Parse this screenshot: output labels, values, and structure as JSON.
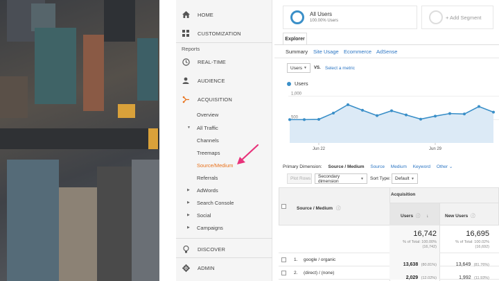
{
  "sidebar": {
    "home": "HOME",
    "customization": "CUSTOMIZATION",
    "reports_label": "Reports",
    "realtime": "REAL-TIME",
    "audience": "AUDIENCE",
    "acquisition": "ACQUISITION",
    "sub": {
      "overview": "Overview",
      "all_traffic": "All Traffic",
      "channels": "Channels",
      "treemaps": "Treemaps",
      "source_medium": "Source/Medium",
      "referrals": "Referrals",
      "adwords": "AdWords",
      "search_console": "Search Console",
      "social": "Social",
      "campaigns": "Campaigns"
    },
    "discover": "DISCOVER",
    "admin": "ADMIN"
  },
  "segments": {
    "all_users_title": "All Users",
    "all_users_sub": "100.00% Users",
    "add_segment": "+ Add Segment"
  },
  "explorer": {
    "tab_label": "Explorer",
    "tabs": [
      "Summary",
      "Site Usage",
      "Ecommerce",
      "AdSense"
    ],
    "metric_dropdown": "Users",
    "vs": "VS.",
    "select_metric": "Select a metric"
  },
  "chart_data": {
    "type": "line",
    "series": [
      {
        "name": "Users",
        "values": [
          500,
          500,
          505,
          640,
          820,
          700,
          585,
          690,
          600,
          510,
          575,
          630,
          620,
          780,
          660
        ]
      }
    ],
    "y_ticks": [
      "1,000",
      "500"
    ],
    "x_labels": [
      "Jun 22",
      "Jun 29"
    ],
    "ylim": [
      0,
      1100
    ],
    "color": "#3a8fc8"
  },
  "dimension": {
    "label": "Primary Dimension:",
    "selected": "Source / Medium",
    "options": [
      "Source",
      "Medium",
      "Keyword",
      "Other ⌄"
    ]
  },
  "toolbar": {
    "plot_rows": "Plot Rows",
    "secondary_dimension": "Secondary dimension",
    "sort_type_label": "Sort Type:",
    "sort_type_value": "Default"
  },
  "table": {
    "acquisition_header": "Acquisition",
    "col_source": "Source / Medium",
    "col_users": "Users",
    "col_new_users": "New Users",
    "totals": {
      "users": "16,742",
      "users_pct": "% of Total: 100.00%",
      "users_abs": "(16,742)",
      "new_users": "16,695",
      "new_users_pct": "% of Total: 100.02%",
      "new_users_abs": "(16,692)"
    },
    "rows": [
      {
        "idx": "1.",
        "source": "google / organic",
        "users": "13,638",
        "users_pct": "(80.81%)",
        "new_users": "13,649",
        "new_users_pct": "(81.76%)"
      },
      {
        "idx": "2.",
        "source": "(direct) / (none)",
        "users": "2,029",
        "users_pct": "(12.02%)",
        "new_users": "1,992",
        "new_users_pct": "(11.93%)"
      }
    ]
  },
  "colors": {
    "accent_orange": "#e8711a",
    "link_blue": "#2b75c3",
    "pink_arrow": "#e8327a"
  }
}
